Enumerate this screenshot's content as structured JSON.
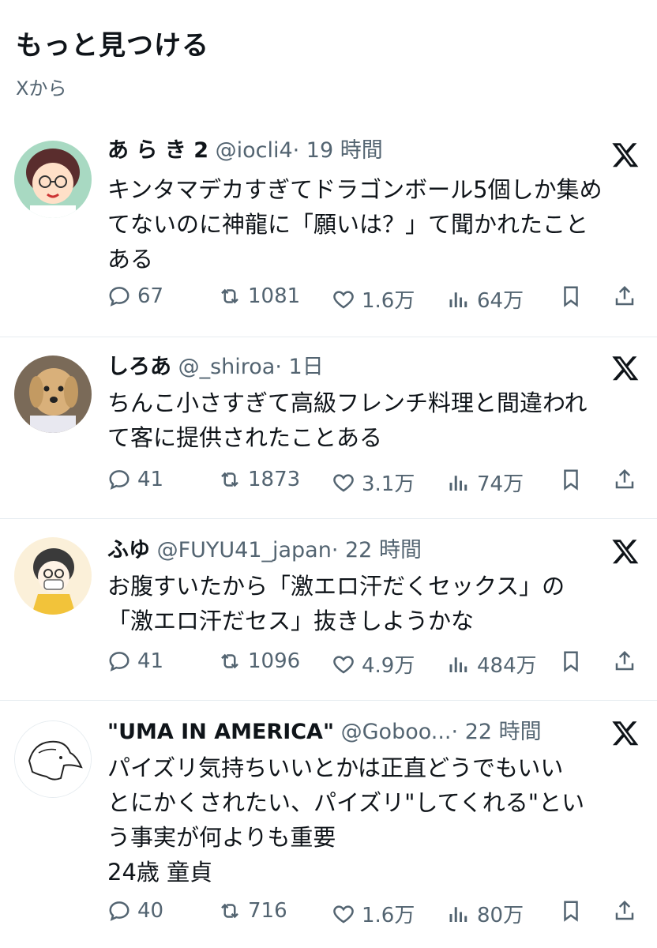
{
  "header": {
    "title": "もっと見つける",
    "subtitle": "Xから"
  },
  "tweets": [
    {
      "name": "あ ら き 2",
      "handle": "@iocli4",
      "time": "· 19 時間",
      "text": "キンタマデカすぎてドラゴンボール5個しか集め\nてないのに神龍に「願いは？」て聞かれたこと\nある",
      "replies": "67",
      "retweets": "1081",
      "likes": "1.6万",
      "views": "64万"
    },
    {
      "name": "しろあ",
      "handle": "@_shiroa",
      "time": "· 1日",
      "text": "ちんこ小さすぎて高級フレンチ料理と間違われ\nて客に提供されたことある",
      "replies": "41",
      "retweets": "1873",
      "likes": "3.1万",
      "views": "74万"
    },
    {
      "name": "ふゆ",
      "handle": "@FUYU41_japan",
      "time": "· 22 時間",
      "text": "お腹すいたから「激エロ汗だくセックス」の\n「激エロ汗だセス」抜きしようかな",
      "replies": "41",
      "retweets": "1096",
      "likes": "4.9万",
      "views": "484万"
    },
    {
      "name": "\"UMA IN AMERICA\"",
      "handle": "@Goboo...",
      "time": "· 22 時間",
      "text": "パイズリ気持ちいいとかは正直どうでもいい\nとにかくされたい、パイズリ\"してくれる\"とい\nう事実が何よりも重要\n24歳 童貞",
      "replies": "40",
      "retweets": "716",
      "likes": "1.6万",
      "views": "80万"
    }
  ],
  "icons": {
    "reply": "reply-icon",
    "retweet": "retweet-icon",
    "like": "like-icon",
    "views": "views-icon",
    "bookmark": "bookmark-icon",
    "share": "share-icon",
    "x": "x-logo-icon"
  },
  "colors": {
    "text": "#0f1419",
    "secondary": "#536471",
    "divider": "#e6ecf0"
  }
}
